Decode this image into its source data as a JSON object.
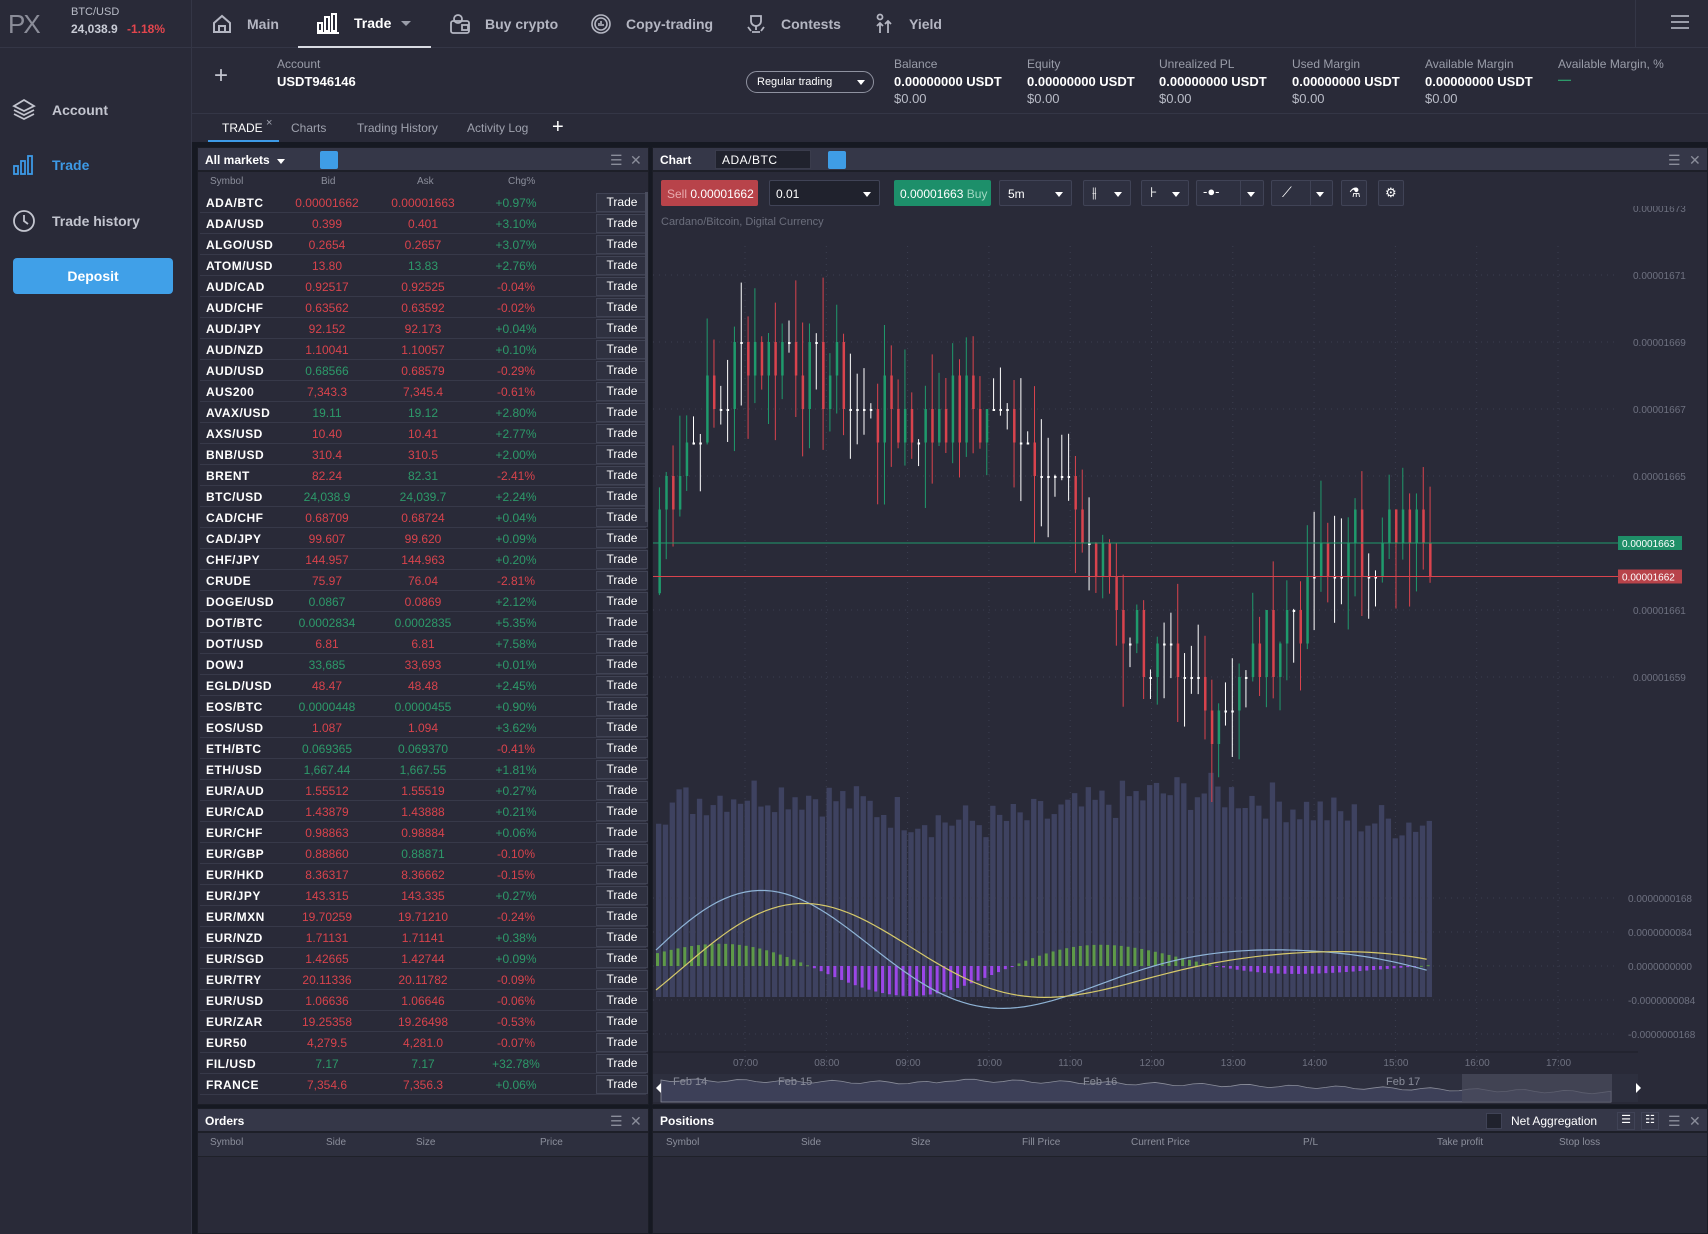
{
  "ticker": {
    "symbol": "BTC/USD",
    "price": "24,038.9",
    "change": "-1.18%"
  },
  "logo": "PX",
  "nav": [
    {
      "label": "Main",
      "icon": "home-icon"
    },
    {
      "label": "Trade",
      "icon": "bar-chart-icon",
      "active": true
    },
    {
      "label": "Buy crypto",
      "icon": "wallet-crypto-icon"
    },
    {
      "label": "Copy-trading",
      "icon": "copy-trading-icon"
    },
    {
      "label": "Contests",
      "icon": "trophy-icon"
    },
    {
      "label": "Yield",
      "icon": "yield-icon"
    }
  ],
  "account": {
    "label": "Account",
    "id": "USDT946146",
    "mode": "Regular trading",
    "stats": [
      {
        "label": "Balance",
        "value": "0.00000000 USDT",
        "usd": "$0.00"
      },
      {
        "label": "Equity",
        "value": "0.00000000 USDT",
        "usd": "$0.00"
      },
      {
        "label": "Unrealized PL",
        "value": "0.00000000 USDT",
        "usd": "$0.00"
      },
      {
        "label": "Used Margin",
        "value": "0.00000000 USDT",
        "usd": "$0.00"
      },
      {
        "label": "Available Margin",
        "value": "0.00000000 USDT",
        "usd": "$0.00"
      },
      {
        "label": "Available Margin, %",
        "value": "—",
        "usd": ""
      }
    ]
  },
  "sidebar": {
    "items": [
      {
        "label": "Account",
        "icon": "layers-icon"
      },
      {
        "label": "Trade",
        "icon": "bar-chart-icon",
        "active": true
      },
      {
        "label": "Trade history",
        "icon": "clock-icon"
      }
    ],
    "deposit": "Deposit"
  },
  "tabs": [
    "TRADE",
    "Charts",
    "Trading History",
    "Activity Log"
  ],
  "markets": {
    "title": "All markets",
    "columns": [
      "Symbol",
      "Bid",
      "Ask",
      "Chg%"
    ],
    "trade_label": "Trade",
    "rows": [
      [
        "ADA/BTC",
        "0.00001662",
        "r",
        "0.00001663",
        "r",
        "+0.97%"
      ],
      [
        "ADA/USD",
        "0.399",
        "r",
        "0.401",
        "r",
        "+3.10%"
      ],
      [
        "ALGO/USD",
        "0.2654",
        "r",
        "0.2657",
        "r",
        "+3.07%"
      ],
      [
        "ATOM/USD",
        "13.80",
        "r",
        "13.83",
        "g",
        "+2.76%"
      ],
      [
        "AUD/CAD",
        "0.92517",
        "r",
        "0.92525",
        "r",
        "-0.04%"
      ],
      [
        "AUD/CHF",
        "0.63562",
        "r",
        "0.63592",
        "r",
        "-0.02%"
      ],
      [
        "AUD/JPY",
        "92.152",
        "r",
        "92.173",
        "r",
        "+0.04%"
      ],
      [
        "AUD/NZD",
        "1.10041",
        "r",
        "1.10057",
        "r",
        "+0.10%"
      ],
      [
        "AUD/USD",
        "0.68566",
        "g",
        "0.68579",
        "r",
        "-0.29%"
      ],
      [
        "AUS200",
        "7,343.3",
        "r",
        "7,345.4",
        "r",
        "-0.61%"
      ],
      [
        "AVAX/USD",
        "19.11",
        "g",
        "19.12",
        "g",
        "+2.80%"
      ],
      [
        "AXS/USD",
        "10.40",
        "r",
        "10.41",
        "r",
        "+2.77%"
      ],
      [
        "BNB/USD",
        "310.4",
        "r",
        "310.5",
        "r",
        "+2.00%"
      ],
      [
        "BRENT",
        "82.24",
        "r",
        "82.31",
        "g",
        "-2.41%"
      ],
      [
        "BTC/USD",
        "24,038.9",
        "g",
        "24,039.7",
        "g",
        "+2.24%"
      ],
      [
        "CAD/CHF",
        "0.68709",
        "r",
        "0.68724",
        "r",
        "+0.04%"
      ],
      [
        "CAD/JPY",
        "99.607",
        "r",
        "99.620",
        "r",
        "+0.09%"
      ],
      [
        "CHF/JPY",
        "144.957",
        "r",
        "144.963",
        "r",
        "+0.20%"
      ],
      [
        "CRUDE",
        "75.97",
        "r",
        "76.04",
        "r",
        "-2.81%"
      ],
      [
        "DOGE/USD",
        "0.0867",
        "g",
        "0.0869",
        "r",
        "+2.12%"
      ],
      [
        "DOT/BTC",
        "0.0002834",
        "g",
        "0.0002835",
        "g",
        "+5.35%"
      ],
      [
        "DOT/USD",
        "6.81",
        "r",
        "6.81",
        "r",
        "+7.58%"
      ],
      [
        "DOWJ",
        "33,685",
        "g",
        "33,693",
        "r",
        "+0.01%"
      ],
      [
        "EGLD/USD",
        "48.47",
        "r",
        "48.48",
        "r",
        "+2.45%"
      ],
      [
        "EOS/BTC",
        "0.0000448",
        "g",
        "0.0000455",
        "g",
        "+0.90%"
      ],
      [
        "EOS/USD",
        "1.087",
        "r",
        "1.094",
        "r",
        "+3.62%"
      ],
      [
        "ETH/BTC",
        "0.069365",
        "g",
        "0.069370",
        "g",
        "-0.41%"
      ],
      [
        "ETH/USD",
        "1,667.44",
        "g",
        "1,667.55",
        "g",
        "+1.81%"
      ],
      [
        "EUR/AUD",
        "1.55512",
        "r",
        "1.55519",
        "r",
        "+0.27%"
      ],
      [
        "EUR/CAD",
        "1.43879",
        "r",
        "1.43888",
        "r",
        "+0.21%"
      ],
      [
        "EUR/CHF",
        "0.98863",
        "r",
        "0.98884",
        "r",
        "+0.06%"
      ],
      [
        "EUR/GBP",
        "0.88860",
        "r",
        "0.88871",
        "g",
        "-0.10%"
      ],
      [
        "EUR/HKD",
        "8.36317",
        "r",
        "8.36662",
        "r",
        "-0.15%"
      ],
      [
        "EUR/JPY",
        "143.315",
        "r",
        "143.335",
        "r",
        "+0.27%"
      ],
      [
        "EUR/MXN",
        "19.70259",
        "r",
        "19.71210",
        "r",
        "-0.24%"
      ],
      [
        "EUR/NZD",
        "1.71131",
        "r",
        "1.71141",
        "r",
        "+0.38%"
      ],
      [
        "EUR/SGD",
        "1.42665",
        "r",
        "1.42744",
        "r",
        "+0.09%"
      ],
      [
        "EUR/TRY",
        "20.11336",
        "r",
        "20.11782",
        "r",
        "-0.09%"
      ],
      [
        "EUR/USD",
        "1.06636",
        "r",
        "1.06646",
        "r",
        "-0.06%"
      ],
      [
        "EUR/ZAR",
        "19.25358",
        "r",
        "19.26498",
        "r",
        "-0.53%"
      ],
      [
        "EUR50",
        "4,279.5",
        "r",
        "4,281.0",
        "r",
        "-0.07%"
      ],
      [
        "FIL/USD",
        "7.17",
        "g",
        "7.17",
        "g",
        "+32.78%"
      ],
      [
        "FRANCE",
        "7,354.6",
        "r",
        "7,356.3",
        "r",
        "+0.06%"
      ]
    ]
  },
  "chart": {
    "title": "Chart",
    "symbol": "ADA/BTC",
    "sell_label": "Sell",
    "sell_price": "0.00001662",
    "buy_price": "0.00001663",
    "buy_label": "Buy",
    "quantity": "0.01",
    "interval": "5m",
    "instrument_desc": "Cardano/Bitcoin, Digital Currency",
    "price_axis": [
      "0.00001673",
      "0.00001671",
      "0.00001669",
      "0.00001667",
      "0.00001665",
      "0.00001661",
      "0.00001659"
    ],
    "ask_line": "0.00001663",
    "bid_line": "0.00001662",
    "macd_axis": [
      "0.0000000168",
      "0.0000000084",
      "0.0000000000",
      "-0.0000000084",
      "-0.0000000168"
    ],
    "time_axis": [
      "07:00",
      "08:00",
      "09:00",
      "10:00",
      "11:00",
      "12:00",
      "13:00",
      "14:00",
      "15:00",
      "16:00",
      "17:00"
    ],
    "navigator_dates": [
      "Feb 14",
      "Feb 15",
      "Feb 16",
      "Feb 17"
    ]
  },
  "orders": {
    "title": "Orders",
    "columns": [
      "Symbol",
      "Side",
      "Size",
      "Price"
    ]
  },
  "positions": {
    "title": "Positions",
    "net_aggregation": "Net Aggregation",
    "columns": [
      "Symbol",
      "Side",
      "Size",
      "Fill Price",
      "Current Price",
      "P/L",
      "Take profit",
      "Stop loss"
    ]
  },
  "colors": {
    "accent": "#3d9ae6",
    "up": "#2d9a6a",
    "down": "#d8434c",
    "background": "#292a38"
  }
}
